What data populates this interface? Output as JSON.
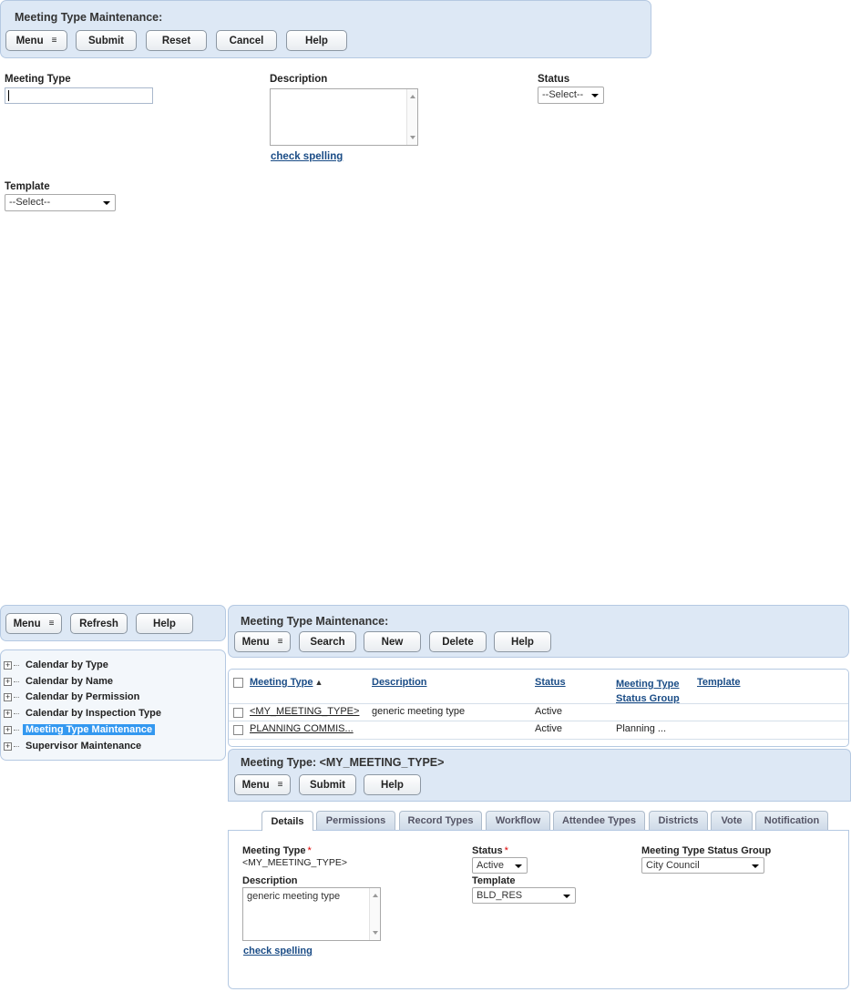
{
  "top_form": {
    "title": "Meeting Type Maintenance:",
    "toolbar": {
      "menu": "Menu",
      "submit": "Submit",
      "reset": "Reset",
      "cancel": "Cancel",
      "help": "Help"
    },
    "meeting_type_label": "Meeting Type",
    "meeting_type_value": "",
    "description_label": "Description",
    "description_value": "",
    "check_spelling": "check spelling",
    "status_label": "Status",
    "status_value": "--Select--",
    "template_label": "Template",
    "template_value": "--Select--"
  },
  "left_nav": {
    "toolbar": {
      "menu": "Menu",
      "refresh": "Refresh",
      "help": "Help"
    },
    "items": [
      {
        "label": "Calendar by Type"
      },
      {
        "label": "Calendar by Name"
      },
      {
        "label": "Calendar by Permission"
      },
      {
        "label": "Calendar by Inspection Type"
      },
      {
        "label": "Meeting Type Maintenance"
      },
      {
        "label": "Supervisor Maintenance"
      }
    ]
  },
  "list_panel": {
    "title": "Meeting Type Maintenance:",
    "toolbar": {
      "menu": "Menu",
      "search": "Search",
      "new": "New",
      "delete": "Delete",
      "help": "Help"
    },
    "columns": {
      "meeting_type": "Meeting Type",
      "sort_indicator": "▲",
      "description": "Description",
      "status": "Status",
      "status_group_1": "Meeting Type",
      "status_group_2": "Status Group",
      "template": "Template"
    },
    "rows": [
      {
        "meeting_type": "<MY_MEETING_TYPE>",
        "description": "generic meeting type",
        "status": "Active",
        "status_group": "",
        "template": ""
      },
      {
        "meeting_type": "PLANNING COMMIS...",
        "description": "",
        "status": "Active",
        "status_group": "Planning ...",
        "template": ""
      }
    ]
  },
  "detail_panel": {
    "title": "Meeting Type: <MY_MEETING_TYPE>",
    "toolbar": {
      "menu": "Menu",
      "submit": "Submit",
      "help": "Help"
    },
    "tabs": [
      "Details",
      "Permissions",
      "Record Types",
      "Workflow",
      "Attendee Types",
      "Districts",
      "Vote",
      "Notification"
    ],
    "required_mark": "*",
    "meeting_type_label": "Meeting Type",
    "meeting_type_value": "<MY_MEETING_TYPE>",
    "description_label": "Description",
    "description_value": "generic meeting type",
    "check_spelling": "check spelling",
    "status_label": "Status",
    "status_value": "Active",
    "template_label": "Template",
    "template_value": "BLD_RES",
    "status_group_label": "Meeting Type Status Group",
    "status_group_value": "City Council"
  }
}
